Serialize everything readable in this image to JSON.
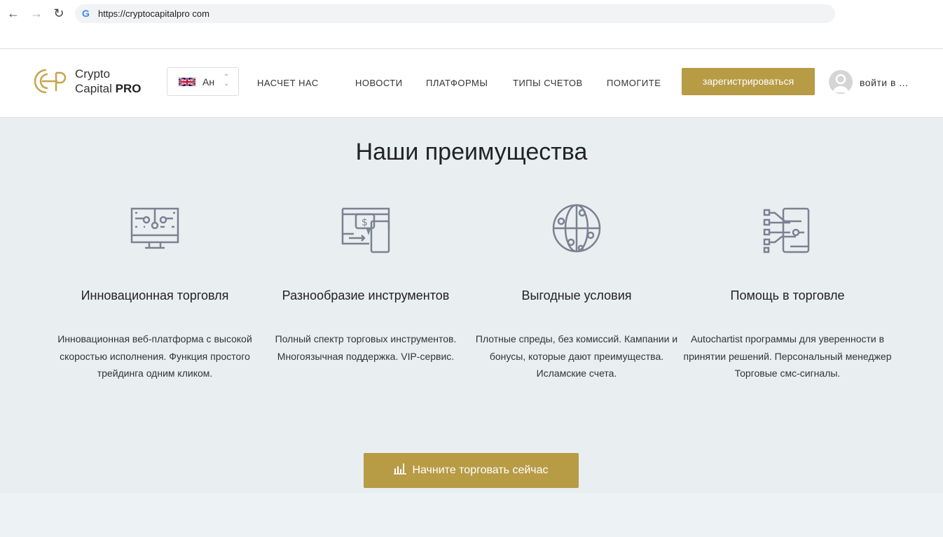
{
  "browser": {
    "url": "https://cryptocapitalpro com",
    "back": "←",
    "forward": "→",
    "reload": "↻",
    "g": "G"
  },
  "header": {
    "logo_line1": "Crypto",
    "logo_line2": "Capital",
    "logo_bold": "PRO",
    "lang": "Ан",
    "nav": [
      "НАСЧЕТ НАС",
      "НОВОСТИ",
      "ПЛАТФОРМЫ",
      "ТИПЫ СЧЕТОВ",
      "ПОМОГИТЕ"
    ],
    "register": "зарегистрироваться",
    "login": "войти в ..."
  },
  "main": {
    "title": "Наши преимущества",
    "features": [
      {
        "title": "Инновационная торговля",
        "text": "Инновационная веб-платформа с высокой скоростью исполнения. Функция простого трейдинга одним кликом.",
        "icon": "monitor-circuit-icon"
      },
      {
        "title": "Разнообразие инструментов",
        "text": "Полный спектр торговых инструментов. Многоязычная поддержка. VIP-сервис.",
        "icon": "dollar-chat-device-icon"
      },
      {
        "title": "Выгодные условия",
        "text": "Плотные спреды, без комиссий. Кампании и бонусы, которые дают преимущества. Исламские счета.",
        "icon": "globe-circuit-icon"
      },
      {
        "title": "Помощь в торговле",
        "text": "Autochartist программы для уверенности в принятии решений. Персональный менеджер Торговые смс-сигналы.",
        "icon": "phone-circuit-icon"
      }
    ],
    "cta": "Начните торговать сейчас"
  },
  "colors": {
    "gold": "#b89b45",
    "icon": "#7a8190"
  }
}
